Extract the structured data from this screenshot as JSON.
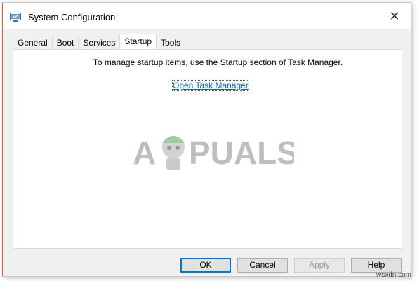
{
  "window": {
    "title": "System Configuration",
    "close_glyph": "✕"
  },
  "tabs": [
    {
      "label": "General",
      "active": false
    },
    {
      "label": "Boot",
      "active": false
    },
    {
      "label": "Services",
      "active": false
    },
    {
      "label": "Startup",
      "active": true
    },
    {
      "label": "Tools",
      "active": false
    }
  ],
  "startup": {
    "message": "To manage startup items, use the Startup section of Task Manager.",
    "link_label": "Open Task Manager"
  },
  "buttons": {
    "ok": "OK",
    "cancel": "Cancel",
    "apply": "Apply",
    "help": "Help"
  },
  "watermark": {
    "left": "A",
    "right": "PUALS"
  },
  "site_mark": "wsxdn.com",
  "colors": {
    "link": "#0066cc",
    "accent_default_button": "#0078d7"
  },
  "icons": {
    "app": "system-configuration-icon",
    "close": "close-icon"
  }
}
